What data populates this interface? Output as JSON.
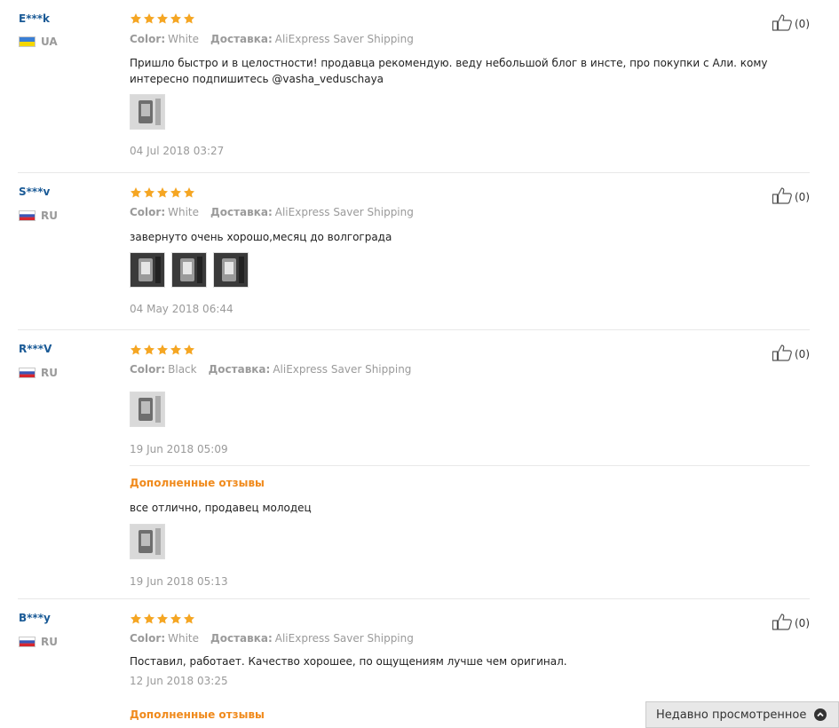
{
  "reviews": [
    {
      "user": "E***k",
      "country": "UA",
      "rating": 5,
      "color_label": "Color:",
      "color_value": "White",
      "shipping_label": "Доставка:",
      "shipping_value": "AliExpress Saver Shipping",
      "text": "Пришло быстро и в целостности! продавца рекомендую. веду небольшой блог в инсте, про покупки с Али. кому интересно подпишитесь @vasha_veduschaya",
      "photos": 1,
      "date": "04 Jul 2018 03:27",
      "helpful_count": "(0)"
    },
    {
      "user": "S***v",
      "country": "RU",
      "rating": 5,
      "color_label": "Color:",
      "color_value": "White",
      "shipping_label": "Доставка:",
      "shipping_value": "AliExpress Saver Shipping",
      "text": "завернуто очень хорошо,месяц до волгограда",
      "photos": 3,
      "date": "04 May 2018 06:44",
      "helpful_count": "(0)"
    },
    {
      "user": "R***V",
      "country": "RU",
      "rating": 5,
      "color_label": "Color:",
      "color_value": "Black",
      "shipping_label": "Доставка:",
      "shipping_value": "AliExpress Saver Shipping",
      "text": "",
      "photos": 1,
      "date": "19 Jun 2018 05:09",
      "helpful_count": "(0)",
      "additional": {
        "title": "Дополненные отзывы",
        "text": "все отлично, продавец молодец",
        "photos": 1,
        "date": "19 Jun 2018 05:13"
      }
    },
    {
      "user": "B***y",
      "country": "RU",
      "rating": 5,
      "color_label": "Color:",
      "color_value": "White",
      "shipping_label": "Доставка:",
      "shipping_value": "AliExpress Saver Shipping",
      "text": "Поставил, работает. Качество хорошее, по ощущениям лучше чем оригинал.",
      "photos": 0,
      "date": "12 Jun 2018 03:25",
      "helpful_count": "(0)",
      "additional": {
        "title": "Дополненные отзывы",
        "text": "",
        "photos": 0,
        "date": ""
      }
    }
  ],
  "recently_viewed": {
    "label": "Недавно просмотренное",
    "icon": "chevron-up-icon"
  },
  "colors": {
    "username": "#1a5a96",
    "star": "#f5a623",
    "additional_title": "#f08a1c",
    "muted": "#9a9a9a"
  }
}
